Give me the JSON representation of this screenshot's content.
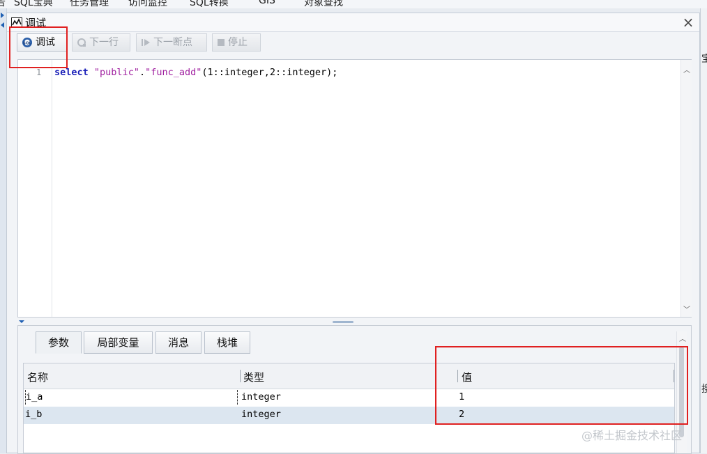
{
  "menu": {
    "items": [
      "SQL宝典",
      "任务管理",
      "访问监控",
      "SQL转换",
      "GIS",
      "对象查找"
    ],
    "first_fragment": "告"
  },
  "window": {
    "title": "调试",
    "icon": "chart-line-icon",
    "close_label": "×"
  },
  "toolbar": {
    "debug_label": "调试",
    "debug_icon": "sql-gear-icon",
    "next_line_label": "下一行",
    "next_breakpoint_label": "下一断点",
    "stop_label": "停止"
  },
  "editor": {
    "line_number": "1",
    "code": {
      "keyword": "select",
      "schema": "\"public\"",
      "dot": ".",
      "func": "\"func_add\"",
      "args": "(1::integer,2::integer);"
    }
  },
  "tabs": [
    "参数",
    "局部变量",
    "消息",
    "栈堆"
  ],
  "active_tab": "参数",
  "grid": {
    "columns": [
      "名称",
      "类型",
      "值"
    ],
    "rows": [
      {
        "name": "i_a",
        "type": "integer",
        "value": "1"
      },
      {
        "name": "i_b",
        "type": "integer",
        "value": "2"
      }
    ],
    "selected_row": 1
  },
  "right_strip": {
    "glyph_top": "宝",
    "glyph_bottom": "搜"
  },
  "watermark": "@稀土掘金技术社区",
  "colors": {
    "highlight_red": "#e02020",
    "selected_row": "#dce6f0",
    "keyword": "#1a1fb8",
    "string": "#a020a0"
  }
}
